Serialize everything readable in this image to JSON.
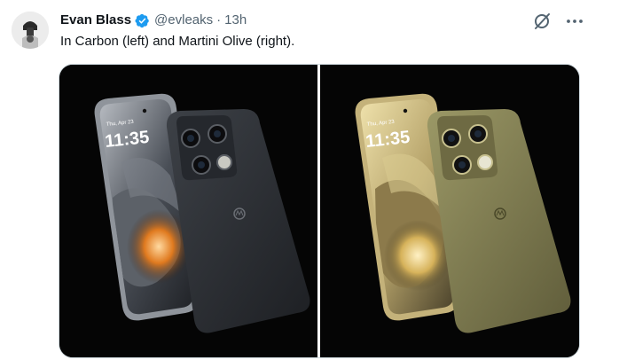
{
  "tweet": {
    "author_name": "Evan Blass",
    "author_handle": "@evleaks",
    "separator": "·",
    "timestamp": "13h",
    "text": "In Carbon (left) and Martini Olive (right).",
    "verified": true
  },
  "media": {
    "images": [
      {
        "phone_time": "11:35",
        "phone_date": "Thu, Apr 23",
        "color": "Carbon"
      },
      {
        "phone_time": "11:35",
        "phone_date": "Thu, Apr 23",
        "color": "Martini Olive"
      }
    ]
  },
  "icons": {
    "verified": "verified-badge-icon",
    "grok": "grok-icon",
    "more": "more-icon"
  },
  "colors": {
    "accent": "#1d9bf0",
    "text_primary": "#0f1419",
    "text_secondary": "#536471",
    "carbon_back": "#2b2e33",
    "olive_back": "#7a774c"
  }
}
